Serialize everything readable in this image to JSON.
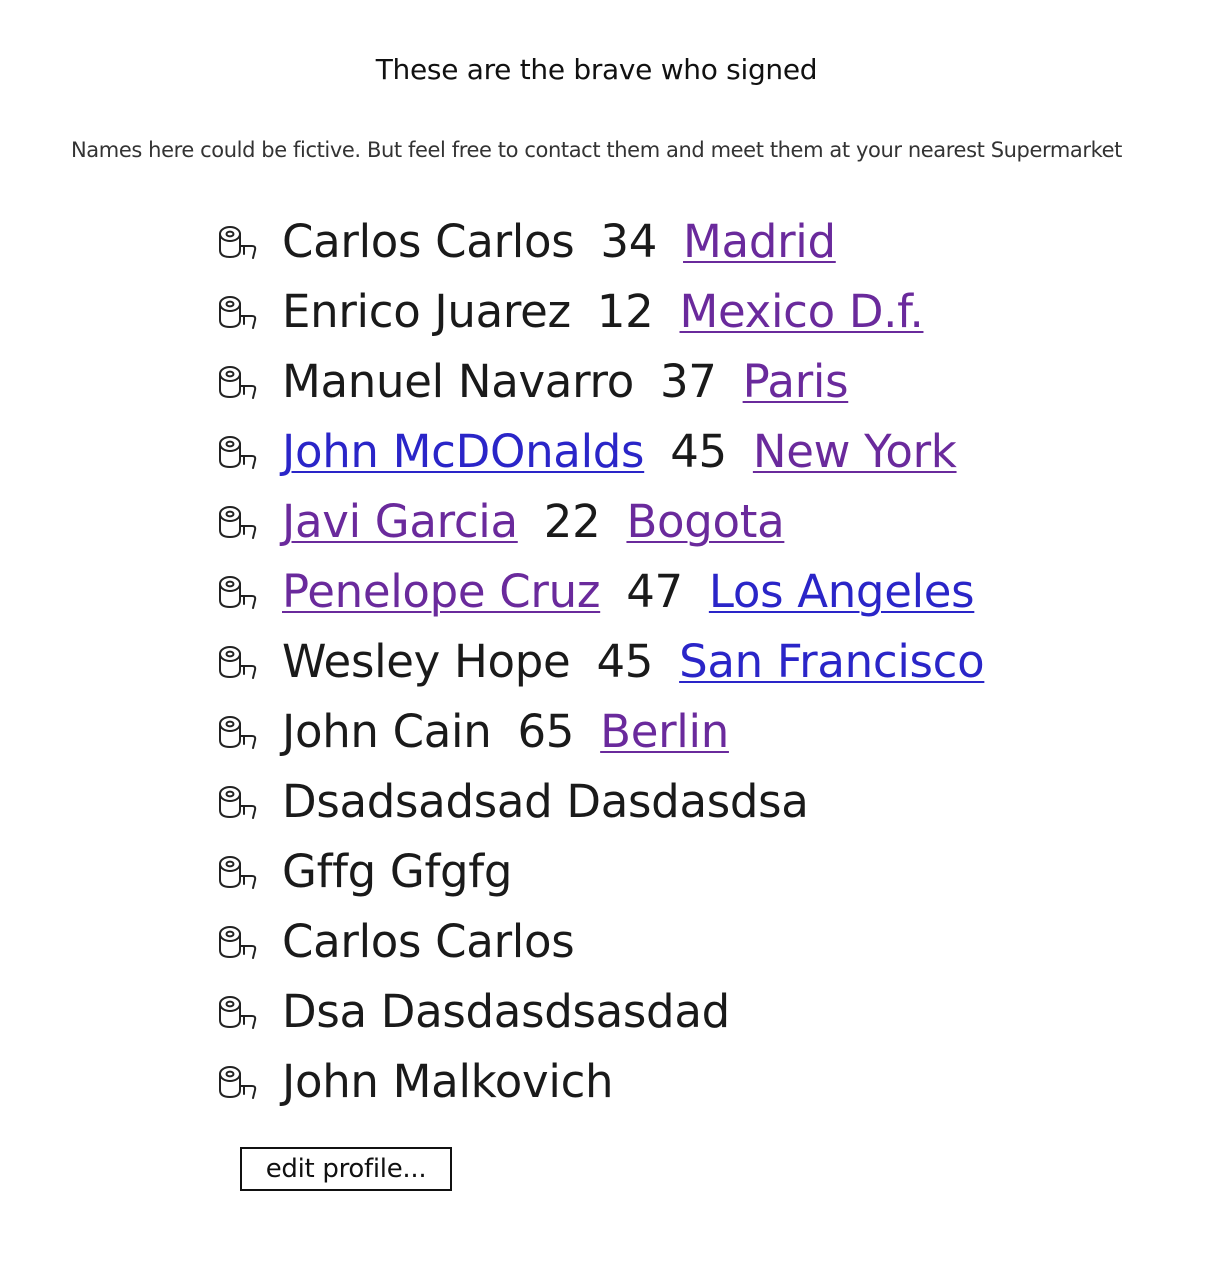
{
  "header": {
    "title": "These are the brave who signed",
    "subtitle": "Names here could be fictive. But feel free to contact them and meet them at your nearest Supermarket"
  },
  "list_icon": "toilet-paper-roll-icon",
  "colors": {
    "link_blue": "#2a25c8",
    "link_visited": "#6a2a9c",
    "text": "#1a1a1a"
  },
  "signers": [
    {
      "name": "Carlos Carlos",
      "age": "34",
      "city": "Madrid",
      "name_link": "none",
      "city_link": "visited"
    },
    {
      "name": "Enrico Juarez",
      "age": "12",
      "city": "Mexico D.f.",
      "name_link": "none",
      "city_link": "visited"
    },
    {
      "name": "Manuel Navarro",
      "age": "37",
      "city": "Paris",
      "name_link": "none",
      "city_link": "visited"
    },
    {
      "name": "John McDOnalds",
      "age": "45",
      "city": "New York",
      "name_link": "blue",
      "city_link": "visited"
    },
    {
      "name": "Javi Garcia",
      "age": "22",
      "city": "Bogota",
      "name_link": "visited",
      "city_link": "visited"
    },
    {
      "name": "Penelope Cruz",
      "age": "47",
      "city": "Los Angeles",
      "name_link": "visited",
      "city_link": "blue"
    },
    {
      "name": "Wesley Hope",
      "age": "45",
      "city": "San Francisco",
      "name_link": "none",
      "city_link": "blue"
    },
    {
      "name": "John Cain",
      "age": "65",
      "city": "Berlin",
      "name_link": "none",
      "city_link": "visited"
    },
    {
      "name": "Dsadsadsad Dasdasdsa",
      "age": "",
      "city": "",
      "name_link": "none",
      "city_link": "none"
    },
    {
      "name": "Gffg Gfgfg",
      "age": "",
      "city": "",
      "name_link": "none",
      "city_link": "none"
    },
    {
      "name": "Carlos Carlos",
      "age": "",
      "city": "",
      "name_link": "none",
      "city_link": "none"
    },
    {
      "name": "Dsa Dasdasdsasdad",
      "age": "",
      "city": "",
      "name_link": "none",
      "city_link": "none"
    },
    {
      "name": "John Malkovich",
      "age": "",
      "city": "",
      "name_link": "none",
      "city_link": "none"
    }
  ],
  "actions": {
    "edit_profile_label": "edit profile..."
  }
}
